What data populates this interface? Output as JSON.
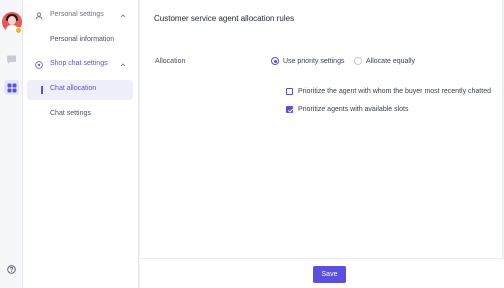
{
  "rail": {
    "icons": [
      "avatar",
      "chat-bubble-icon",
      "apps-grid-icon",
      "help-icon"
    ]
  },
  "nav": {
    "groups": [
      {
        "label": "Personal settings",
        "icon": "user-icon",
        "expanded": true,
        "items": [
          {
            "label": "Personal information"
          }
        ]
      },
      {
        "label": "Shop chat settings",
        "icon": "chat-settings-icon",
        "expanded": true,
        "active": true,
        "items": [
          {
            "label": "Chat allocation",
            "selected": true
          },
          {
            "label": "Chat settings"
          }
        ]
      }
    ]
  },
  "main": {
    "title": "Customer service agent allocation rules",
    "allocation": {
      "label": "Allocation",
      "options": [
        {
          "label": "Use priority settings",
          "selected": true
        },
        {
          "label": "Allocate equally",
          "selected": false
        }
      ]
    },
    "priorities": [
      {
        "label": "Prioritize the agent with whom the buyer most recently chatted",
        "checked": false
      },
      {
        "label": "Prioritize agents with available slots",
        "checked": true
      }
    ],
    "save_label": "Save"
  },
  "colors": {
    "accent": "#5b4fe0",
    "selected_bg": "#eeeffa",
    "avatar_bg": "#e85a5a",
    "badge": "#f5b21b"
  }
}
